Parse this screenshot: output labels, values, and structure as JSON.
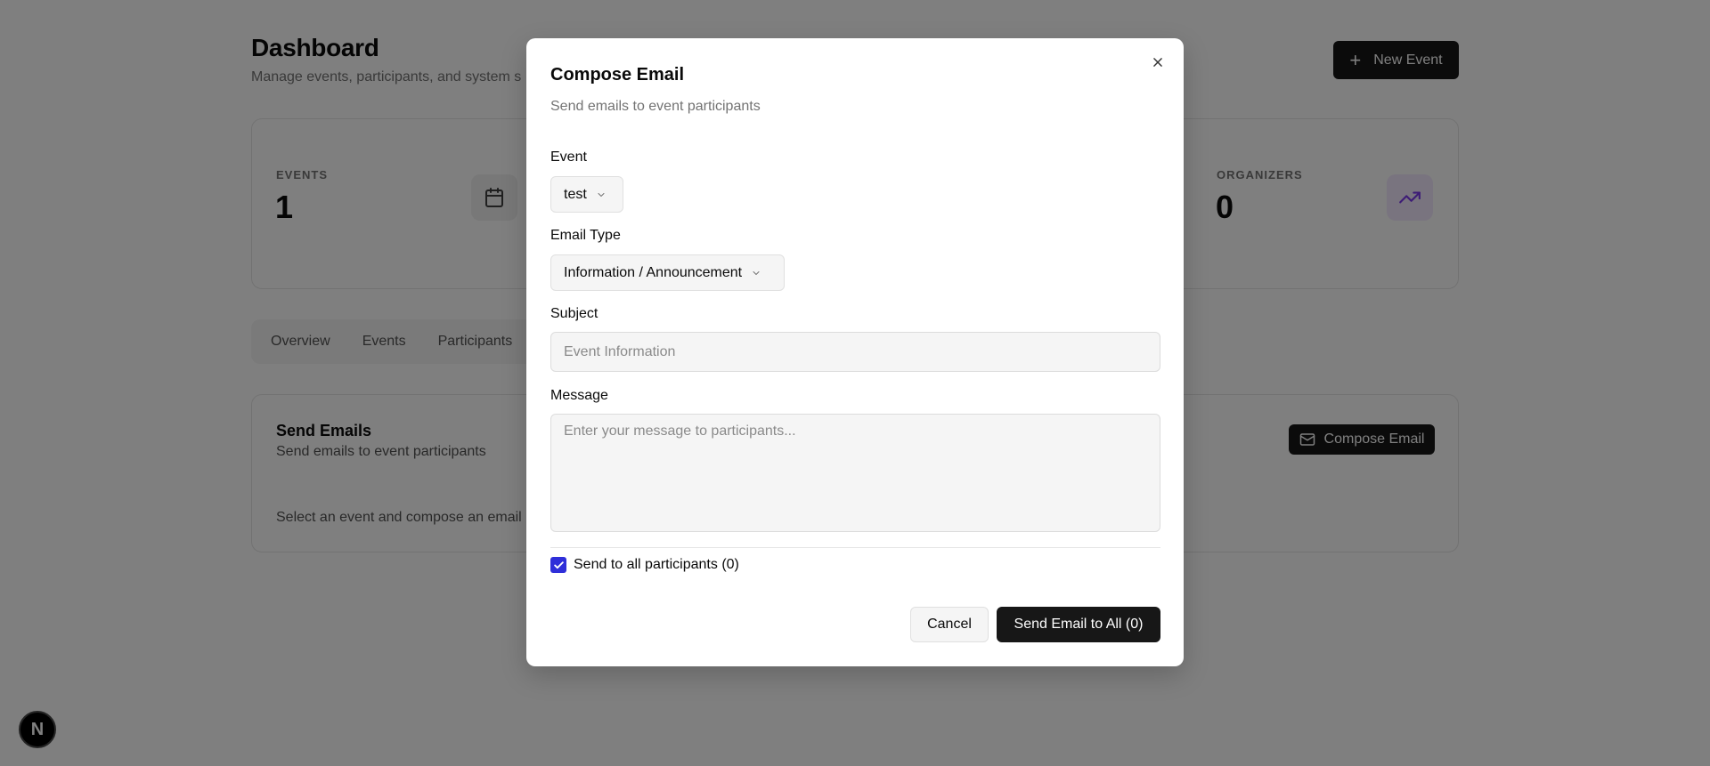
{
  "dashboard": {
    "title": "Dashboard",
    "subtitle": "Manage events, participants, and system s",
    "new_event_label": "New Event",
    "stats": [
      {
        "label": "EVENTS",
        "value": "1",
        "icon": "calendar-icon"
      },
      {
        "label": "ORGANIZERS",
        "value": "0",
        "icon": "trending-up-icon"
      }
    ],
    "tabs": [
      "Overview",
      "Events",
      "Participants"
    ],
    "email_card": {
      "title": "Send Emails",
      "subtitle": "Send emails to event participants",
      "empty_text": "Select an event and compose an email",
      "compose_label": "Compose Email"
    },
    "badge_letter": "N"
  },
  "modal": {
    "title": "Compose Email",
    "description": "Send emails to event participants",
    "event_label": "Event",
    "event_value": "test",
    "email_type_label": "Email Type",
    "email_type_value": "Information / Announcement",
    "subject_label": "Subject",
    "subject_placeholder": "Event Information",
    "message_label": "Message",
    "message_placeholder": "Enter your message to participants...",
    "send_all_label": "Send to all participants (0)",
    "send_all_checked": true,
    "cancel_label": "Cancel",
    "send_label": "Send Email to All (0)"
  },
  "colors": {
    "primary": "#171717",
    "checkbox": "#2f2fd9",
    "accent_purple": "#7c3aed"
  }
}
